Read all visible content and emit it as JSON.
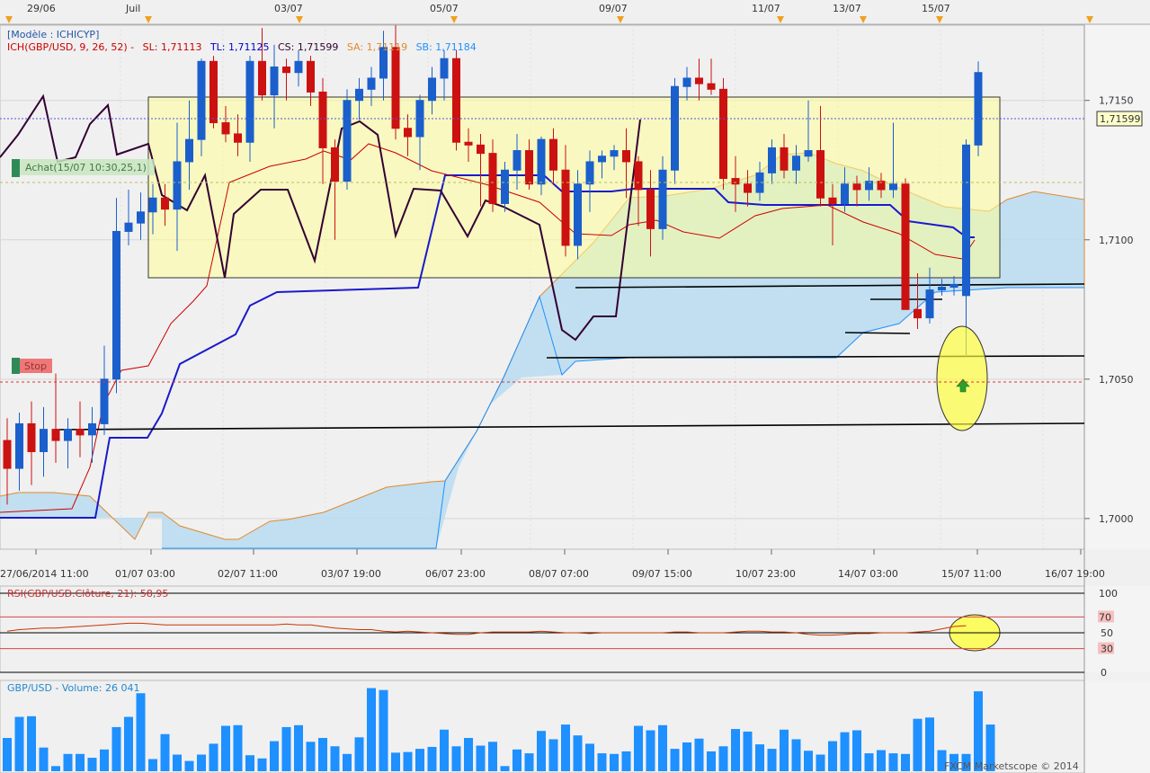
{
  "top_dates": [
    "29/06",
    "Juil",
    "03/07",
    "05/07",
    "09/07",
    "11/07",
    "13/07",
    "15/07"
  ],
  "legend": {
    "model": "[Modèle : ICHICYP]",
    "ich": "ICH(GBP/USD, 9, 26, 52) -",
    "sl": "SL: 1,71113",
    "tl": "TL: 1,71125",
    "cs": "CS: 1,71599",
    "sa": "SA: 1,71119",
    "sb": "SB: 1,71184",
    "colors": {
      "ich": "#cc0000",
      "sl": "#cc0000",
      "tl": "#0000cc",
      "cs": "#330033",
      "sa": "#e08a2c",
      "sb": "#1e90ff"
    }
  },
  "annotations": {
    "buy": "Achat(15/07 10:30,25,1)",
    "stop": "Stop"
  },
  "price_axis": {
    "labels": [
      "1,7150",
      "1,7100",
      "1,7050",
      "1,7000"
    ],
    "current": "1,71599"
  },
  "time_axis": [
    "27/06/2014 11:00",
    "01/07 03:00",
    "02/07 11:00",
    "03/07 19:00",
    "06/07 23:00",
    "08/07 07:00",
    "09/07 15:00",
    "10/07 23:00",
    "14/07 03:00",
    "15/07 11:00",
    "16/07 19:00"
  ],
  "rsi": {
    "label": "RSI(GBP/USD.Clôture, 21): 58,95",
    "levels": [
      "100",
      "70",
      "50",
      "30",
      "0"
    ]
  },
  "volume": {
    "label": "GBP/USD - Volume: 26 041"
  },
  "copyright": "FXCM Marketscope © 2014",
  "chart_data": [
    {
      "type": "candlestick",
      "series": [
        {
          "name": "GBP/USD",
          "ohlc": [
            [
              1.7028,
              1.7036,
              1.7005,
              1.7018
            ],
            [
              1.7018,
              1.7038,
              1.701,
              1.7034
            ],
            [
              1.7034,
              1.7042,
              1.7012,
              1.7024
            ],
            [
              1.7024,
              1.704,
              1.7015,
              1.7032
            ],
            [
              1.7032,
              1.7052,
              1.702,
              1.7028
            ],
            [
              1.7028,
              1.7036,
              1.7018,
              1.7032
            ],
            [
              1.7032,
              1.7042,
              1.7022,
              1.703
            ],
            [
              1.703,
              1.704,
              1.702,
              1.7034
            ],
            [
              1.7034,
              1.7062,
              1.703,
              1.705
            ],
            [
              1.705,
              1.7115,
              1.7045,
              1.7103
            ],
            [
              1.7103,
              1.7118,
              1.7098,
              1.7106
            ],
            [
              1.7106,
              1.7117,
              1.71,
              1.711
            ],
            [
              1.711,
              1.712,
              1.7102,
              1.7115
            ],
            [
              1.7115,
              1.712,
              1.7105,
              1.7111
            ],
            [
              1.7111,
              1.7142,
              1.7096,
              1.7128
            ],
            [
              1.7128,
              1.715,
              1.7118,
              1.7136
            ],
            [
              1.7136,
              1.7165,
              1.713,
              1.7164
            ],
            [
              1.7164,
              1.7166,
              1.714,
              1.7142
            ],
            [
              1.7142,
              1.7148,
              1.7135,
              1.7138
            ],
            [
              1.7138,
              1.7145,
              1.713,
              1.7135
            ],
            [
              1.7135,
              1.7166,
              1.7128,
              1.7164
            ],
            [
              1.7164,
              1.7176,
              1.715,
              1.7152
            ],
            [
              1.7152,
              1.717,
              1.714,
              1.7162
            ],
            [
              1.7162,
              1.7165,
              1.715,
              1.716
            ],
            [
              1.716,
              1.7168,
              1.7155,
              1.7164
            ],
            [
              1.7164,
              1.7166,
              1.7148,
              1.7153
            ],
            [
              1.7153,
              1.7158,
              1.712,
              1.7133
            ],
            [
              1.7133,
              1.7136,
              1.71,
              1.7121
            ],
            [
              1.7121,
              1.7154,
              1.7118,
              1.715
            ],
            [
              1.715,
              1.7158,
              1.7143,
              1.7154
            ],
            [
              1.7154,
              1.7162,
              1.7148,
              1.7158
            ],
            [
              1.7158,
              1.7175,
              1.715,
              1.7169
            ],
            [
              1.7169,
              1.7177,
              1.7136,
              1.714
            ],
            [
              1.714,
              1.7145,
              1.713,
              1.7137
            ],
            [
              1.7137,
              1.7152,
              1.7125,
              1.715
            ],
            [
              1.715,
              1.7162,
              1.7145,
              1.7158
            ],
            [
              1.7158,
              1.7168,
              1.715,
              1.7165
            ],
            [
              1.7165,
              1.7168,
              1.7132,
              1.7135
            ],
            [
              1.7135,
              1.714,
              1.7128,
              1.7134
            ],
            [
              1.7134,
              1.7138,
              1.7112,
              1.7131
            ],
            [
              1.7131,
              1.7136,
              1.711,
              1.7113
            ],
            [
              1.7113,
              1.7128,
              1.711,
              1.7125
            ],
            [
              1.7125,
              1.7138,
              1.7118,
              1.7132
            ],
            [
              1.7132,
              1.7136,
              1.7118,
              1.712
            ],
            [
              1.712,
              1.7137,
              1.7116,
              1.7136
            ],
            [
              1.7136,
              1.714,
              1.712,
              1.7125
            ],
            [
              1.7125,
              1.7134,
              1.7094,
              1.7098
            ],
            [
              1.7098,
              1.7125,
              1.7093,
              1.712
            ],
            [
              1.712,
              1.7132,
              1.711,
              1.7128
            ],
            [
              1.7128,
              1.7132,
              1.7122,
              1.713
            ],
            [
              1.713,
              1.7134,
              1.7125,
              1.7132
            ],
            [
              1.7132,
              1.714,
              1.7115,
              1.7128
            ],
            [
              1.7128,
              1.713,
              1.7105,
              1.7118
            ],
            [
              1.7118,
              1.7125,
              1.7094,
              1.7104
            ],
            [
              1.7104,
              1.713,
              1.71,
              1.7125
            ],
            [
              1.7125,
              1.7158,
              1.712,
              1.7155
            ],
            [
              1.7155,
              1.7162,
              1.715,
              1.7158
            ],
            [
              1.7158,
              1.7165,
              1.715,
              1.7156
            ],
            [
              1.7156,
              1.7165,
              1.7152,
              1.7154
            ],
            [
              1.7154,
              1.7158,
              1.7118,
              1.7122
            ],
            [
              1.7122,
              1.713,
              1.711,
              1.712
            ],
            [
              1.712,
              1.7125,
              1.7112,
              1.7117
            ],
            [
              1.7117,
              1.7128,
              1.7114,
              1.7124
            ],
            [
              1.7124,
              1.7136,
              1.712,
              1.7133
            ],
            [
              1.7133,
              1.7138,
              1.7122,
              1.7125
            ],
            [
              1.7125,
              1.7134,
              1.712,
              1.713
            ],
            [
              1.713,
              1.715,
              1.7128,
              1.7132
            ],
            [
              1.7132,
              1.7148,
              1.7112,
              1.7115
            ],
            [
              1.7115,
              1.712,
              1.7098,
              1.7113
            ],
            [
              1.7113,
              1.7126,
              1.711,
              1.712
            ],
            [
              1.712,
              1.7123,
              1.7112,
              1.7118
            ],
            [
              1.7118,
              1.7126,
              1.7114,
              1.7121
            ],
            [
              1.7121,
              1.7124,
              1.7115,
              1.7118
            ],
            [
              1.7118,
              1.7142,
              1.7115,
              1.712
            ],
            [
              1.712,
              1.7122,
              1.7075,
              1.7075
            ],
            [
              1.7075,
              1.7088,
              1.7068,
              1.7072
            ],
            [
              1.7072,
              1.709,
              1.707,
              1.7082
            ],
            [
              1.7082,
              1.7086,
              1.708,
              1.7083
            ],
            [
              1.7083,
              1.7087,
              1.708,
              1.7084
            ],
            [
              1.708,
              1.7136,
              1.7058,
              1.7134
            ],
            [
              1.7134,
              1.7164,
              1.713,
              1.716
            ]
          ]
        }
      ],
      "ylim": [
        1.6989,
        1.7177
      ]
    },
    {
      "type": "line",
      "title": "RSI(GBP/USD.Clôture, 21): 58,95",
      "ylim": [
        0,
        100
      ],
      "series": [
        {
          "name": "RSI",
          "values": [
            52,
            54,
            55,
            56,
            56,
            57,
            58,
            59,
            60,
            61,
            62,
            62,
            61,
            60,
            60,
            60,
            60,
            60,
            60,
            60,
            60,
            60,
            60,
            61,
            60,
            60,
            58,
            56,
            55,
            54,
            54,
            52,
            51,
            52,
            51,
            50,
            49,
            48,
            48,
            50,
            51,
            51,
            51,
            51,
            52,
            51,
            50,
            50,
            49,
            50,
            50,
            50,
            50,
            50,
            50,
            51,
            51,
            50,
            50,
            50,
            51,
            52,
            52,
            51,
            51,
            50,
            48,
            47,
            47,
            48,
            49,
            49,
            50,
            50,
            50,
            51,
            52,
            55,
            58,
            59
          ]
        }
      ]
    },
    {
      "type": "bar",
      "title": "GBP/USD - Volume: 26 041",
      "series": [
        {
          "name": "Volume",
          "values": [
            5200,
            8500,
            8600,
            3700,
            800,
            2700,
            2700,
            2100,
            3400,
            6900,
            8500,
            12200,
            1900,
            5800,
            2600,
            1600,
            2600,
            4300,
            7100,
            7200,
            2500,
            2000,
            4700,
            6900,
            7200,
            4600,
            5200,
            3900,
            2700,
            5300,
            13000,
            12700,
            2900,
            3000,
            3500,
            3800,
            6500,
            3900,
            5200,
            4000,
            4600,
            800,
            3400,
            2800,
            6300,
            5000,
            7300,
            5600,
            4300,
            2800,
            2700,
            3100,
            7100,
            6400,
            7200,
            3500,
            4500,
            5100,
            3100,
            3900,
            6600,
            6200,
            4200,
            3500,
            6500,
            5000,
            3200,
            2600,
            4700,
            6100,
            6400,
            2800,
            3300,
            2800,
            2700,
            8200,
            8400,
            3300,
            2700,
            2700,
            12500,
            7300
          ]
        }
      ]
    }
  ]
}
